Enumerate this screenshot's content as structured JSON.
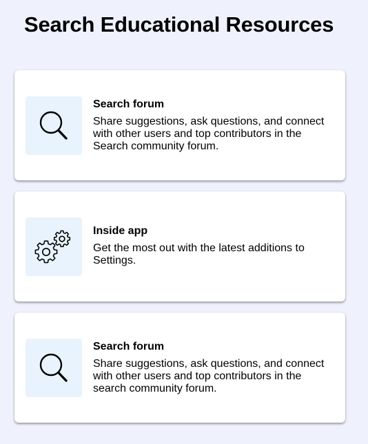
{
  "page": {
    "title": "Search Educational Resources"
  },
  "colors": {
    "background": "#eff2fd",
    "card": "#ffffff",
    "icon_tile": "#e8f3fd"
  },
  "cards": [
    {
      "icon": "magnifier-icon",
      "title": "Search forum",
      "description": "Share suggestions, ask questions, and connect with other users and top contributors in the Search community forum."
    },
    {
      "icon": "gears-icon",
      "title": "Inside app",
      "description": "Get the most out with the latest additions to Settings."
    },
    {
      "icon": "magnifier-icon",
      "title": "Search forum",
      "description": "Share suggestions, ask questions, and connect with other users and top contributors in the search community forum."
    }
  ]
}
